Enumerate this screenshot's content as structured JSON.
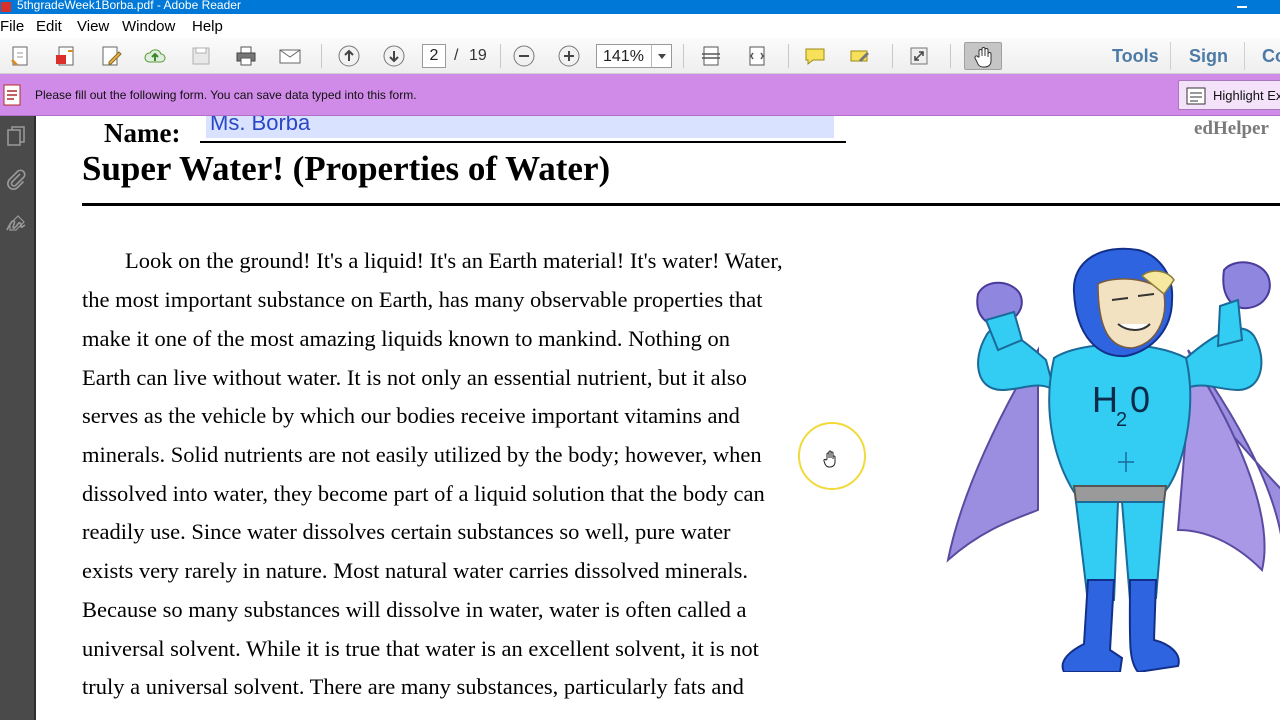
{
  "window": {
    "title": "5thgradeWeek1Borba.pdf - Adobe Reader"
  },
  "menu": {
    "items": [
      {
        "label": "File"
      },
      {
        "label": "Edit"
      },
      {
        "label": "View"
      },
      {
        "label": "Window"
      },
      {
        "label": "Help"
      }
    ]
  },
  "toolbar": {
    "current_page": "2",
    "page_separator": "/",
    "total_pages": "19",
    "zoom": "141%",
    "tools_label": "Tools",
    "sign_label": "Sign",
    "comment_label": "Co"
  },
  "form_bar": {
    "message": "Please fill out the following form. You can save data typed into this form.",
    "highlight_button": "Highlight Exi"
  },
  "document": {
    "name_label": "Name:",
    "name_value": "Ms. Borba",
    "brand": "edHelper",
    "title": "Super Water! (Properties of Water)",
    "paragraph_lines": [
      "Look on the ground! It's a liquid! It's an Earth material! It's water! Water,",
      "the most important substance on Earth, has many observable properties that",
      "make it one of the most amazing liquids known to mankind. Nothing on",
      "Earth can live without water. It is not only an essential nutrient, but it also",
      "serves as the vehicle by which our bodies receive important vitamins and",
      "minerals. Solid nutrients are not easily utilized by the body; however, when",
      "dissolved into water, they become part of a liquid solution that the body can",
      "readily use. Since water dissolves certain substances so well, pure water",
      "exists very rarely in nature. Most natural water carries dissolved minerals.",
      "Because so many substances will dissolve in water, water is often called a",
      "universal solvent. While it is true that water is an excellent solvent, it is not",
      "truly a universal solvent. There are many substances, particularly fats and"
    ],
    "hero_chest_text": "H",
    "hero_chest_subscript": "2",
    "hero_chest_text_end": "0"
  },
  "colors": {
    "titlebar": "#0078d7",
    "formbar": "#d08ae8",
    "field_fill": "#d9e3ff",
    "field_text": "#2b47c8",
    "hero_suit": "#33ccf2",
    "hero_cape": "#9b8ee0"
  },
  "icons": {
    "toolbar": [
      "create-pdf-icon",
      "export-pdf-icon",
      "edit-icon",
      "upload-icon",
      "save-icon",
      "print-icon",
      "email-icon",
      "prev-page-icon",
      "next-page-icon",
      "zoom-out-icon",
      "zoom-in-icon",
      "fit-page-icon",
      "fit-width-icon",
      "comment-icon",
      "highlight-icon",
      "fullscreen-icon",
      "hand-tool-icon"
    ],
    "left_pane": [
      "page-thumbnails-icon",
      "attachments-icon",
      "signatures-icon"
    ]
  }
}
